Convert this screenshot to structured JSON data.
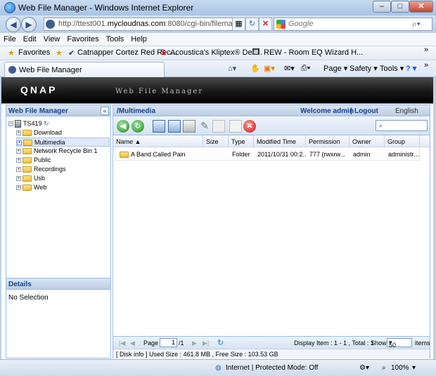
{
  "window": {
    "title": "Web File Manager - Windows Internet Explorer",
    "minimize": "–",
    "maximize": "□",
    "close": "✕"
  },
  "address": {
    "url_prefix": "http://ttest001.",
    "url_domain": "mycloudnas.com",
    "url_suffix": ":8080/cgi-bin/filemanag",
    "search_placeholder": "Google"
  },
  "menu": [
    "File",
    "Edit",
    "View",
    "Favorites",
    "Tools",
    "Help"
  ],
  "favorites": {
    "label": "Favorites",
    "links": [
      "Catnapper Cortez Red Rec...",
      "Acoustica's Kliptex® Dec...",
      "REW - Room EQ Wizard H..."
    ],
    "more": "»"
  },
  "tab": {
    "title": "Web File Manager"
  },
  "commands": {
    "page": "Page ▾",
    "safety": "Safety ▾",
    "tools": "Tools ▾",
    "help": "? ▾",
    "more": "»"
  },
  "app": {
    "logo": "QNAP",
    "subtitle": "Web File Manager"
  },
  "left_panel": {
    "title": "Web File Manager",
    "collapse": "«",
    "root": "TS419",
    "folders": [
      "Download",
      "Multimedia",
      "Network Recycle Bin 1",
      "Public",
      "Recordings",
      "Usb",
      "Web"
    ],
    "selected": "Multimedia",
    "details_title": "Details",
    "details_text": "No Selection"
  },
  "right_panel": {
    "path": "/Multimedia",
    "welcome": "Welcome admin",
    "separator": "|",
    "logout": "Logout",
    "language": "English",
    "search_icon": "search-icon"
  },
  "table": {
    "columns": [
      "Name ▲",
      "Size",
      "Type",
      "Modified Time",
      "Permission",
      "Owner",
      "Group"
    ],
    "rows": [
      {
        "name": "A Band Called Pain",
        "size": "",
        "type": "Folder",
        "modified": "2011/10/31 00:2...",
        "permission": "777 (rwxrw...",
        "owner": "admin",
        "group": "administr..."
      }
    ]
  },
  "pager": {
    "page_label": "Page",
    "page": "1",
    "of": "/1",
    "display": "Display Item : 1 - 1 , Total : 1",
    "show_label": "Show",
    "show_value": "50",
    "items_label": "items"
  },
  "disk": {
    "info": "[ Disk info ] Used Size : 461.8 MB , Free Size : 103.53 GB"
  },
  "status": {
    "zone": "Internet | Protected Mode: Off",
    "zoom": "100%"
  },
  "colors": {
    "brand_header": "#000000",
    "panel_header": "#15428b",
    "border": "#99bbe8"
  }
}
